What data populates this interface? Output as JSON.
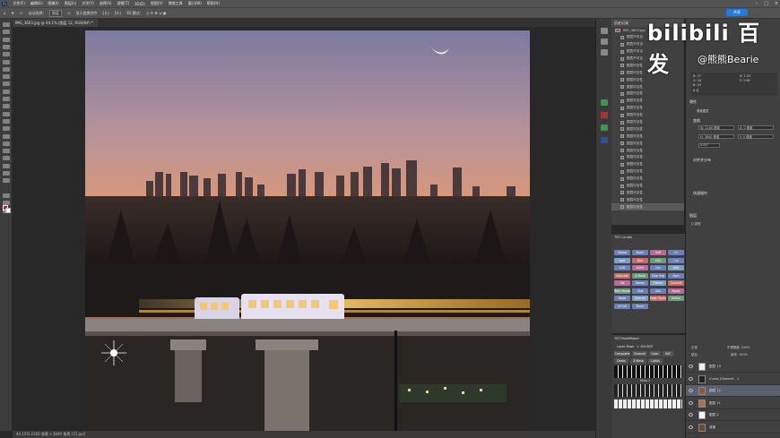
{
  "menubar": {
    "items": [
      "文件(F)",
      "编辑(E)",
      "图像(I)",
      "图层(L)",
      "文字(Y)",
      "选择(S)",
      "滤镜(T)",
      "3D(D)",
      "视图(V)",
      "增效工具",
      "窗口(W)",
      "帮助(H)"
    ]
  },
  "optionsbar": {
    "auto_select": "自动选择:",
    "layer_select": "图层",
    "show_transform": "显示变换控件",
    "share": "共享"
  },
  "document": {
    "tab_title": "IMG_3603.jpg @ 44.1% (图层 12, RGB/8#) *",
    "status": "44.15%   2160 像素 x 3840 像素 (72 ppi)"
  },
  "history": {
    "title": "历史记录",
    "source": "IMG_3603.jpg",
    "items": [
      "图层不可见",
      "图层不可见",
      "图层不可见",
      "图层不可见",
      "图层可见性",
      "图层可见性",
      "图层可见性",
      "图层可见性",
      "图层可见性",
      "图层可见性",
      "图层可见性",
      "图层可见性",
      "图层可见性",
      "图层可见性",
      "图层可见性",
      "图层可见性",
      "图层可见性",
      "图层可见性",
      "图层可见性",
      "图层可见性",
      "图层可见性",
      "图层可见性",
      "图层可见性",
      "图层可见性",
      "图层可见性"
    ]
  },
  "plugin_a": {
    "title": "TKT-Curves",
    "buttons": [
      "Stamp",
      "Norm",
      "Soft",
      "Clr",
      "Lum",
      "Blur",
      "AOS",
      "Col",
      "LUM",
      "HUES",
      "Del",
      "Add",
      "Saturate",
      "Z-Mask",
      "Dup Img",
      "Sym",
      "Tgt",
      "Stamp",
      "Flatten",
      "Convert",
      "Web Sharpen",
      "Vvd",
      "Abs",
      "Apply",
      "Make",
      "Opacity",
      "Edge Sharp",
      "Active",
      "of Full",
      "Done"
    ]
  },
  "plugin_b": {
    "title": "TKT-PanelMaker",
    "layer_mask": "Layer Mask",
    "source": "1. SOURCE",
    "tabs": [
      "Composite",
      "Channel",
      "Color",
      "SAT"
    ],
    "row2": [
      "Darks",
      "Z-Mask",
      "Lights"
    ],
    "mids": "Mids-1"
  },
  "properties": {
    "title": "属性",
    "sub1": "像素图层",
    "transform": "变换",
    "w": "W: 2160 像素",
    "x": "X: 0 像素",
    "h": "H: 3840 像素",
    "y": "Y: 0 像素",
    "angle": "0.00°",
    "align": "对齐并分布",
    "quick": "快速操作",
    "info_lines": [
      "R: 17",
      "G: 16",
      "B: 20",
      "8 位",
      "X: 1.53",
      "Y: 3.96"
    ]
  },
  "layers": {
    "title": "图层",
    "kind": "Q 类型",
    "mode": "正常",
    "opacity": "不透明度: 100%",
    "lock": "锁定:",
    "fill": "填充: 100%",
    "rows": [
      "图层 13",
      "Curve_Element - 1",
      "图层 12",
      "图层 11",
      "图层 2",
      "背景"
    ]
  },
  "watermark": {
    "brand": "bilibili 百发",
    "user": "@熊熊Bearie"
  },
  "colors": {
    "accent": "#1f7be0",
    "panel": "#404040",
    "plugin_button": "#6b7fb8",
    "foreground": "#d01818"
  }
}
